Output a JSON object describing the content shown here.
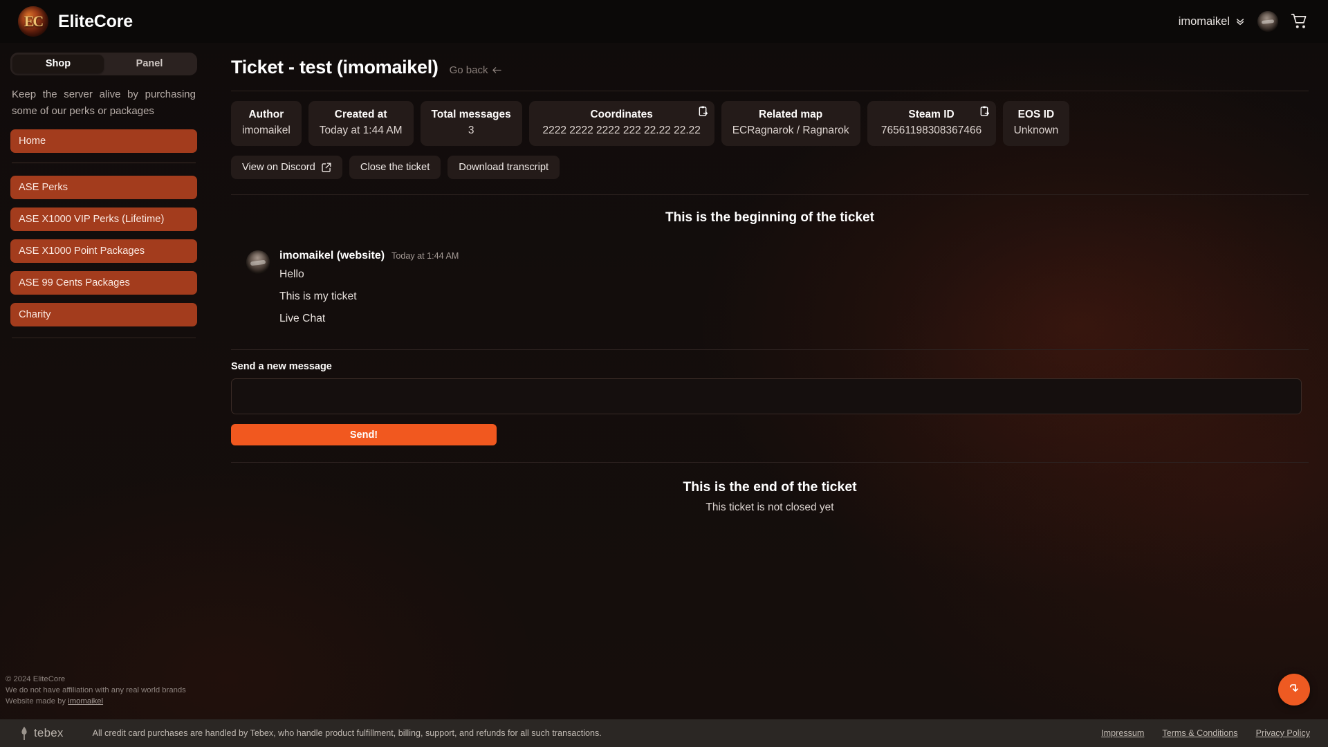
{
  "topbar": {
    "brand_mark": "EC",
    "brand_name": "EliteCore",
    "user_name": "imomaikel",
    "chevron_icon": "chevron-down-icon",
    "avatar_icon": "user-avatar",
    "cart_icon": "shopping-cart-icon"
  },
  "sidebar": {
    "tabs": [
      {
        "label": "Shop",
        "active": true
      },
      {
        "label": "Panel",
        "active": false
      }
    ],
    "blurb": "Keep the server alive by purchasing some of our perks or packages",
    "primary_links": [
      {
        "label": "Home"
      }
    ],
    "category_links": [
      {
        "label": "ASE Perks"
      },
      {
        "label": "ASE X1000 VIP Perks (Lifetime)"
      },
      {
        "label": "ASE X1000 Point Packages"
      },
      {
        "label": "ASE 99 Cents Packages"
      },
      {
        "label": "Charity"
      }
    ],
    "footer": {
      "copyright": "© 2024 EliteCore",
      "disclaimer": "We do not have affiliation with any real world brands",
      "made_by_prefix": "Website made by ",
      "made_by_link": "imomaikel"
    }
  },
  "main": {
    "title": "Ticket - test (imomaikel)",
    "go_back": "Go back",
    "go_back_icon": "arrow-left-icon",
    "info_cards": [
      {
        "label": "Author",
        "value": "imomaikel",
        "copy": false
      },
      {
        "label": "Created at",
        "value": "Today at 1:44 AM",
        "copy": false
      },
      {
        "label": "Total messages",
        "value": "3",
        "copy": false
      },
      {
        "label": "Coordinates",
        "value": "2222 2222 2222 222 22.22 22.22",
        "copy": true
      },
      {
        "label": "Related map",
        "value": "ECRagnarok / Ragnarok",
        "copy": false
      },
      {
        "label": "Steam ID",
        "value": "76561198308367466",
        "copy": true
      },
      {
        "label": "EOS ID",
        "value": "Unknown",
        "copy": false
      }
    ],
    "buttons": [
      {
        "label": "View on Discord",
        "icon": "external-link-icon"
      },
      {
        "label": "Close the ticket",
        "icon": ""
      },
      {
        "label": "Download transcript",
        "icon": ""
      }
    ],
    "begin_text": "This is the beginning of the ticket",
    "messages": [
      {
        "author": "imomaikel (website)",
        "time": "Today at 1:44 AM",
        "lines": [
          "Hello",
          "This is my ticket",
          "Live Chat"
        ]
      }
    ],
    "compose": {
      "label": "Send a new message",
      "value": "",
      "placeholder": "",
      "send_label": "Send!"
    },
    "end_text": "This is the end of the ticket",
    "end_subtext": "This ticket is not closed yet",
    "scroll_button_icon": "arrow-down-icon"
  },
  "tebex": {
    "brand": "tebex",
    "notice": "All credit card purchases are handled by Tebex, who handle product fulfillment, billing, support, and refunds for all such transactions.",
    "links": [
      {
        "label": "Impressum"
      },
      {
        "label": "Terms & Conditions"
      },
      {
        "label": "Privacy Policy"
      }
    ]
  },
  "colors": {
    "accent": "#f1581f",
    "sidebar_link": "#a33c1d",
    "card_bg": "#241b19",
    "page_bg": "#100c0b",
    "tebex_bar": "#2b2724"
  }
}
